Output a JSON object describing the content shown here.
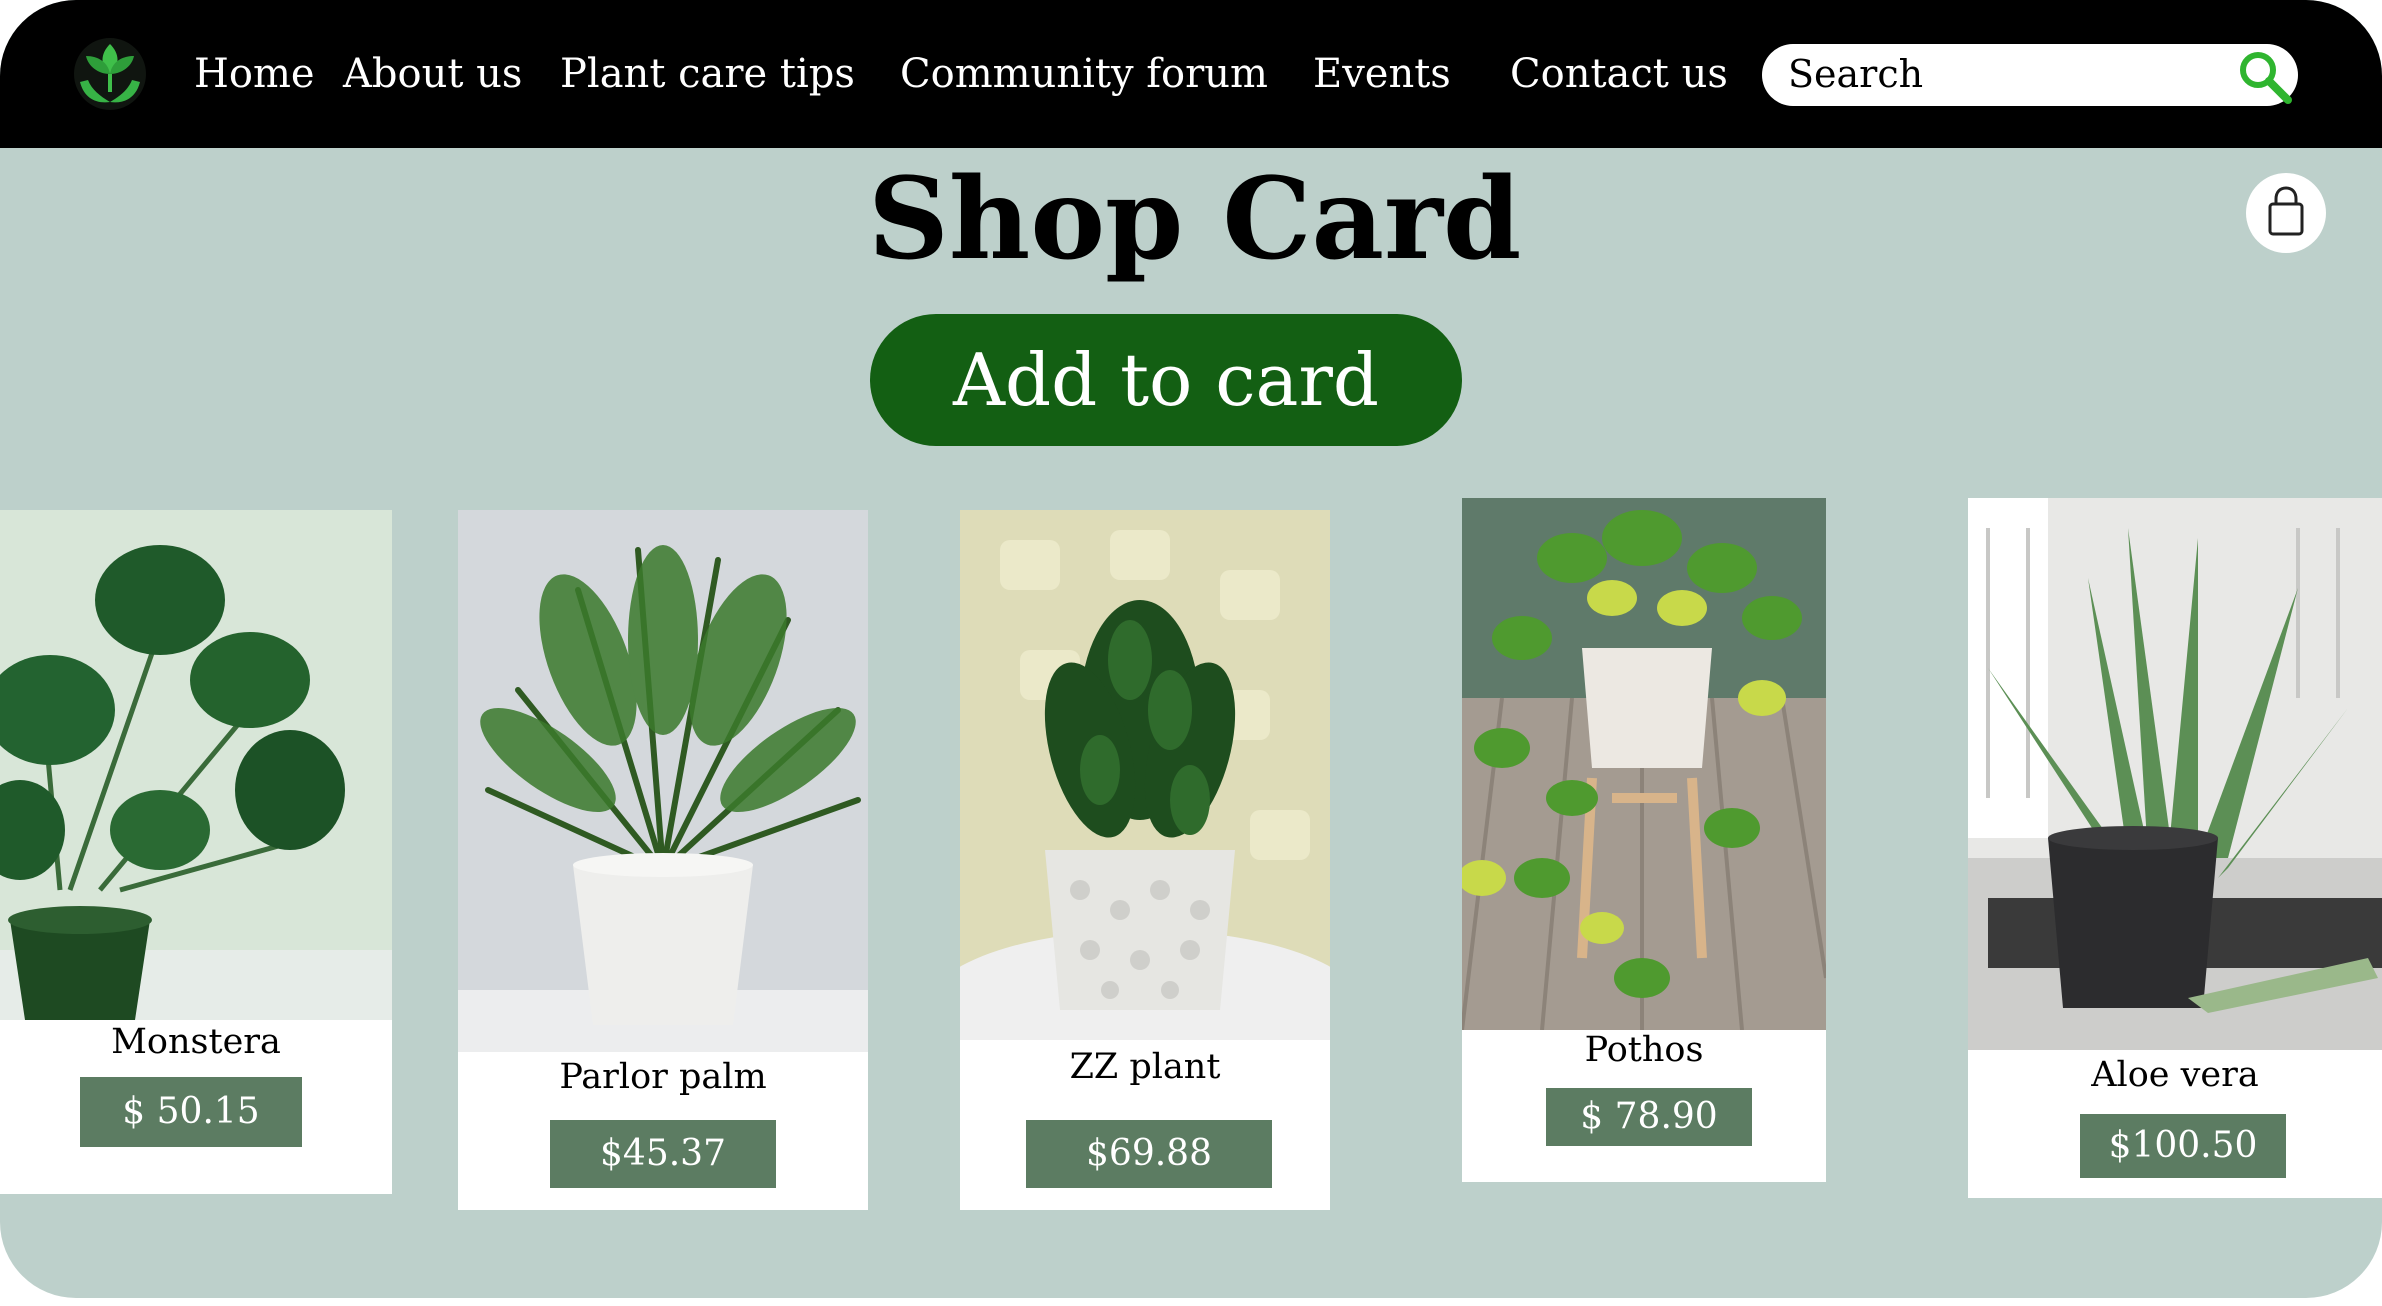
{
  "nav": {
    "items": [
      {
        "label": "Home"
      },
      {
        "label": "About us"
      },
      {
        "label": "Plant care tips"
      },
      {
        "label": "Community forum"
      },
      {
        "label": "Events"
      },
      {
        "label": "Contact us"
      }
    ],
    "search_placeholder": "Search"
  },
  "page": {
    "title": "Shop Card",
    "add_button_label": "Add to card"
  },
  "products": [
    {
      "name": "Monstera",
      "price": "$ 50.15"
    },
    {
      "name": "Parlor palm",
      "price": "$45.37"
    },
    {
      "name": "ZZ plant",
      "price": "$69.88"
    },
    {
      "name": "Pothos",
      "price": "$ 78.90"
    },
    {
      "name": "Aloe vera",
      "price": "$100.50"
    }
  ],
  "colors": {
    "background": "#bdd0cb",
    "navbar": "#000000",
    "accent_button": "#135f13",
    "price_tag": "#5c7c62",
    "search_icon": "#2fb52f"
  },
  "icons": {
    "logo": "plant-hands-logo-icon",
    "search": "magnifier-icon",
    "cart": "shopping-bag-icon"
  }
}
